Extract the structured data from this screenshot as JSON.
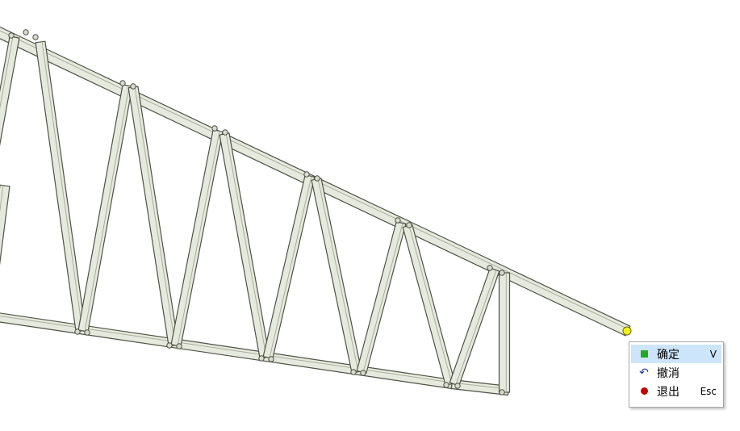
{
  "canvas": {
    "model": "truss",
    "colors": {
      "member_fill": "#e6e9dd",
      "member_edge": "#4f5247",
      "member_shade": "#a9ad9c",
      "pick_point": "#f2f21a"
    }
  },
  "context_menu": {
    "items": [
      {
        "icon": "green-square-icon",
        "label": "确定",
        "shortcut": "V",
        "active": true
      },
      {
        "icon": "undo-icon",
        "label": "撤消",
        "shortcut": "",
        "active": false
      },
      {
        "icon": "red-dot-icon",
        "label": "退出",
        "shortcut": "Esc",
        "active": false
      }
    ]
  }
}
